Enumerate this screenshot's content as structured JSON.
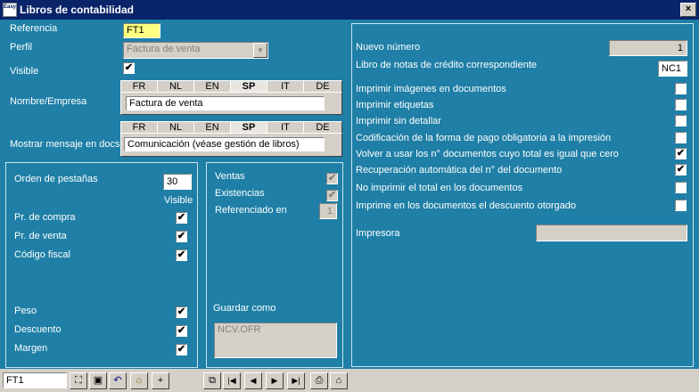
{
  "window": {
    "title": "Libros de contabilidad",
    "icon_text": "Easy",
    "close": "×"
  },
  "header": {
    "referencia_label": "Referencia",
    "referencia_value": "FT1",
    "perfil_label": "Perfil",
    "perfil_value": "Factura de venta",
    "visible_label": "Visible",
    "visible_checked": "✔",
    "nombre_label": "Nombre/Empresa",
    "mensaje_label": "Mostrar mensaje en docs.",
    "languages": [
      "FR",
      "NL",
      "EN",
      "SP",
      "IT",
      "DE"
    ],
    "active_language": "SP",
    "nombre_value": "Factura de venta",
    "mensaje_value": "Comunicación (véase gestión de libros)"
  },
  "left_panel": {
    "orden_label": "Orden de pestañas",
    "orden_value": "30",
    "visible_header": "Visible",
    "items": [
      {
        "label": "Pr. de compra",
        "check": "✔"
      },
      {
        "label": "Pr. de venta",
        "check": "✔"
      },
      {
        "label": "Código fiscal",
        "check": "✔"
      },
      {
        "label": "Peso",
        "check": "✔"
      },
      {
        "label": "Descuento",
        "check": "✔"
      },
      {
        "label": "Margen",
        "check": "✔"
      }
    ]
  },
  "middle_panel": {
    "ventas_label": "Ventas",
    "ventas_check": "✔",
    "existencias_label": "Existencias",
    "existencias_check": "✔",
    "referenciado_label": "Referenciado en",
    "referenciado_value": "1",
    "guardar_label": "Guardar como",
    "guardar_value": "NCV.OFR"
  },
  "right_panel": {
    "nuevo_numero_label": "Nuevo número",
    "nuevo_numero_value": "1",
    "libro_notas_label": "Libro de notas de crédito correspondiente",
    "libro_notas_value": "NC1",
    "options": [
      {
        "label": "Imprimir imágenes en documentos",
        "check": ""
      },
      {
        "label": "Imprimir etiquetas",
        "check": ""
      },
      {
        "label": "Imprimir sin detallar",
        "check": ""
      },
      {
        "label": "Codificación de la forma de pago obligatoria a la impresión",
        "check": ""
      },
      {
        "label": "Volver a usar los n° documentos cuyo total es igual que cero",
        "check": "✔"
      },
      {
        "label": "Recuperación automática del n° del documento",
        "check": "✔"
      },
      {
        "label": "No imprimir el total en los documentos",
        "check": ""
      },
      {
        "label": "Imprime en los documentos el descuento otorgado",
        "check": ""
      }
    ],
    "impresora_label": "Impresora",
    "impresora_value": ""
  },
  "bottom_bar": {
    "record_value": "FT1",
    "icons": [
      "binoculars-icon",
      "save-icon",
      "undo-icon",
      "open-folder-icon",
      "new-document-icon",
      "copy-icon",
      "first-record-icon",
      "previous-record-icon",
      "next-record-icon",
      "last-record-icon",
      "print-icon",
      "home-icon"
    ],
    "glyphs": {
      "binoculars": "⛶",
      "save": "▣",
      "undo": "↶",
      "open": "⌂",
      "new": "+",
      "copy": "⧉",
      "first": "|◀",
      "prev": "◀",
      "next": "▶",
      "last": "▶|",
      "print": "⎙",
      "home": "⌂"
    }
  }
}
